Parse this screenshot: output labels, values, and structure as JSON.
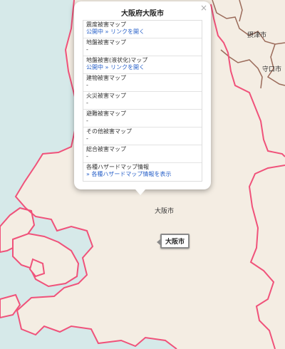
{
  "map": {
    "place_labels": [
      {
        "id": "settsu",
        "text": "摂津市"
      },
      {
        "id": "moriguchi",
        "text": "守口市"
      },
      {
        "id": "osaka",
        "text": "大阪市"
      }
    ],
    "marker_label": "大阪市",
    "colors": {
      "water": "#d6e9e9",
      "land": "#f4ede3",
      "boundary": "#f0527a",
      "city_border": "#9b6b5a"
    }
  },
  "popup": {
    "title": "大阪府大阪市",
    "close_icon": "×",
    "rows": [
      {
        "label": "震度被害マップ",
        "status": "公開中",
        "link": "» リンクを開く"
      },
      {
        "label": "地盤被害マップ",
        "value": "-"
      },
      {
        "label": "地盤被害(液状化)マップ",
        "status": "公開中",
        "link": "» リンクを開く"
      },
      {
        "label": "建物被害マップ",
        "value": "-"
      },
      {
        "label": "火災被害マップ",
        "value": "-"
      },
      {
        "label": "避難被害マップ",
        "value": "-"
      },
      {
        "label": "その他被害マップ",
        "value": "-"
      },
      {
        "label": "総合被害マップ",
        "value": "-"
      },
      {
        "label": "各種ハザードマップ情報",
        "link": "» 各種ハザードマップ情報を表示"
      }
    ]
  }
}
